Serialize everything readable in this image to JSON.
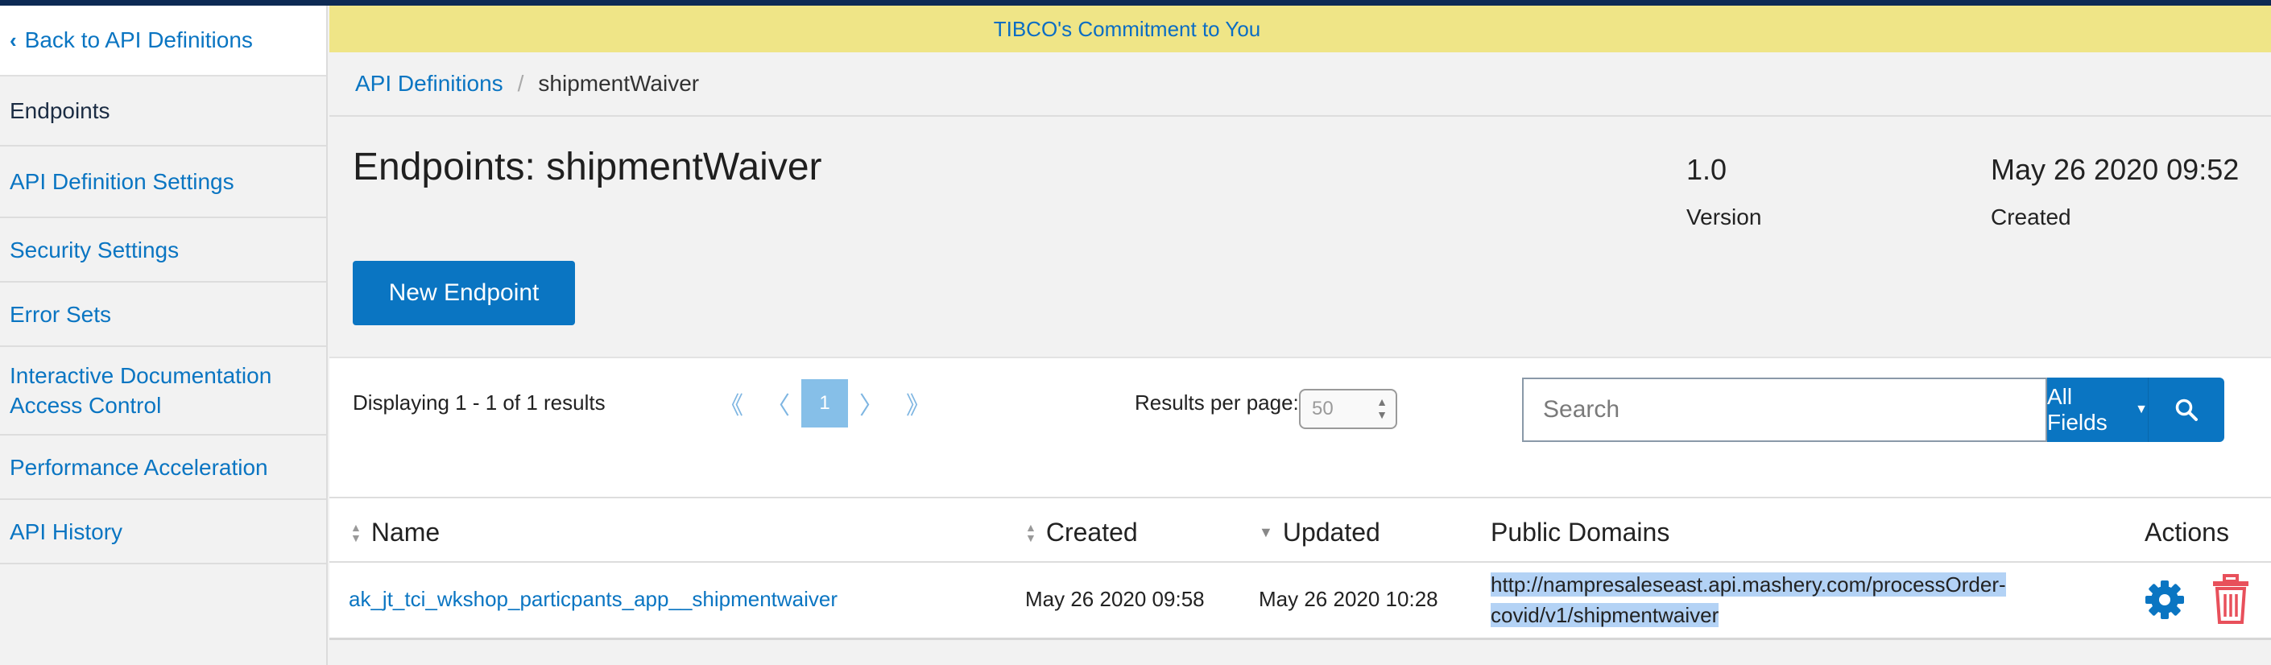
{
  "sidebar": {
    "back_label": "Back to API Definitions",
    "items": [
      {
        "label": "Endpoints"
      },
      {
        "label": "API Definition Settings"
      },
      {
        "label": "Security Settings"
      },
      {
        "label": "Error Sets"
      },
      {
        "label": "Interactive Documentation Access Control"
      },
      {
        "label": "Performance Acceleration"
      },
      {
        "label": "API History"
      }
    ]
  },
  "banner": {
    "text": "TIBCO's Commitment to You"
  },
  "breadcrumb": {
    "parent": "API Definitions",
    "separator": "/",
    "current": "shipmentWaiver"
  },
  "header": {
    "title": "Endpoints: shipmentWaiver",
    "version_value": "1.0",
    "version_label": "Version",
    "created_value": "May 26 2020 09:52",
    "created_label": "Created",
    "new_button": "New Endpoint"
  },
  "controls": {
    "displaying": "Displaying 1 - 1 of 1 results",
    "pager": {
      "first": "《",
      "prev": "〈",
      "current": "1",
      "next": "〉",
      "last": "》"
    },
    "results_per_page_label": "Results per page:",
    "results_per_page_value": "50",
    "search_placeholder": "Search",
    "fields_label": "All Fields"
  },
  "table": {
    "columns": [
      "Name",
      "Created",
      "Updated",
      "Public Domains",
      "Actions"
    ],
    "rows": [
      {
        "name": "ak_jt_tci_wkshop_particpants_app__shipmentwaiver",
        "created": "May 26 2020 09:58",
        "updated": "May 26 2020 10:28",
        "domain_line1": "http://nampresaleseast.api.mashery.com/processOrder-",
        "domain_line2": "covid/v1/shipmentwaiver"
      }
    ]
  },
  "colors": {
    "accent": "#0a75c2",
    "banner": "#efe587",
    "delete": "#e8505b"
  }
}
